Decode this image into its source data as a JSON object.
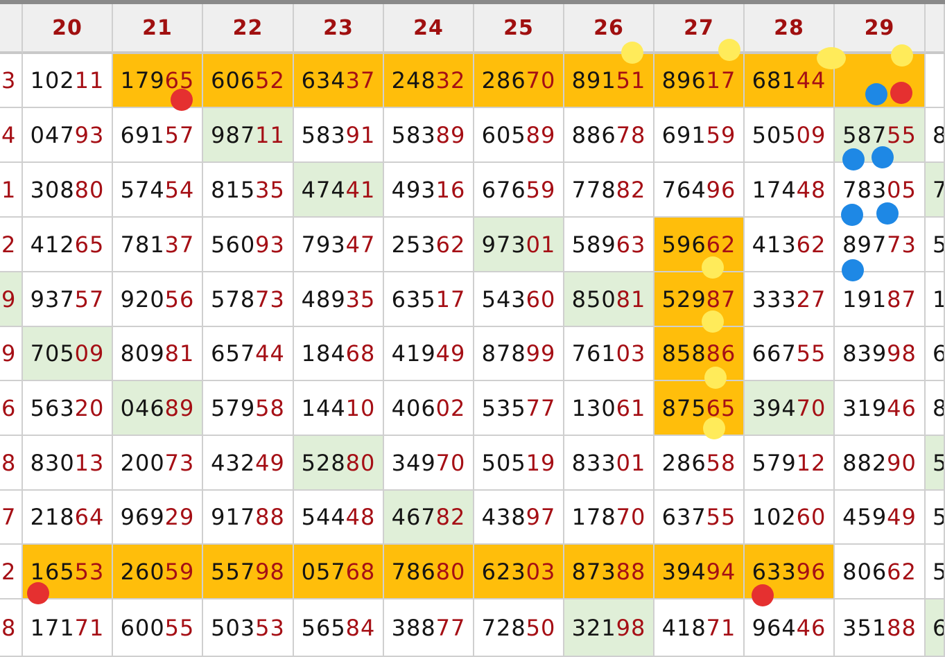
{
  "table": {
    "headers": [
      "20",
      "21",
      "22",
      "23",
      "24",
      "25",
      "26",
      "27",
      "28",
      "29"
    ],
    "left_edge_digits": [
      "3",
      "4",
      "1",
      "2",
      "9",
      "9",
      "6",
      "8",
      "7",
      "2",
      "8"
    ],
    "right_edge_digits": [
      "",
      "8",
      "7",
      "5",
      "1",
      "6",
      "8",
      "5",
      "5",
      "5",
      "6"
    ],
    "rows": [
      [
        [
          "102",
          "11"
        ],
        [
          "179",
          "65"
        ],
        [
          "606",
          "52"
        ],
        [
          "634",
          "37"
        ],
        [
          "248",
          "32"
        ],
        [
          "286",
          "70"
        ],
        [
          "891",
          "51"
        ],
        [
          "896",
          "17"
        ],
        [
          "681",
          "44"
        ],
        [
          "",
          ""
        ]
      ],
      [
        [
          "047",
          "93"
        ],
        [
          "691",
          "57"
        ],
        [
          "987",
          "11"
        ],
        [
          "583",
          "91"
        ],
        [
          "583",
          "89"
        ],
        [
          "605",
          "89"
        ],
        [
          "886",
          "78"
        ],
        [
          "691",
          "59"
        ],
        [
          "505",
          "09"
        ],
        [
          "587",
          "55"
        ]
      ],
      [
        [
          "308",
          "80"
        ],
        [
          "574",
          "54"
        ],
        [
          "815",
          "35"
        ],
        [
          "474",
          "41"
        ],
        [
          "493",
          "16"
        ],
        [
          "676",
          "59"
        ],
        [
          "778",
          "82"
        ],
        [
          "764",
          "96"
        ],
        [
          "174",
          "48"
        ],
        [
          "783",
          "05"
        ]
      ],
      [
        [
          "412",
          "65"
        ],
        [
          "781",
          "37"
        ],
        [
          "560",
          "93"
        ],
        [
          "793",
          "47"
        ],
        [
          "253",
          "62"
        ],
        [
          "973",
          "01"
        ],
        [
          "589",
          "63"
        ],
        [
          "596",
          "62"
        ],
        [
          "413",
          "62"
        ],
        [
          "897",
          "73"
        ]
      ],
      [
        [
          "937",
          "57"
        ],
        [
          "920",
          "56"
        ],
        [
          "578",
          "73"
        ],
        [
          "489",
          "35"
        ],
        [
          "635",
          "17"
        ],
        [
          "543",
          "60"
        ],
        [
          "850",
          "81"
        ],
        [
          "529",
          "87"
        ],
        [
          "333",
          "27"
        ],
        [
          "191",
          "87"
        ]
      ],
      [
        [
          "705",
          "09"
        ],
        [
          "809",
          "81"
        ],
        [
          "657",
          "44"
        ],
        [
          "184",
          "68"
        ],
        [
          "419",
          "49"
        ],
        [
          "878",
          "99"
        ],
        [
          "761",
          "03"
        ],
        [
          "858",
          "86"
        ],
        [
          "667",
          "55"
        ],
        [
          "839",
          "98"
        ]
      ],
      [
        [
          "563",
          "20"
        ],
        [
          "046",
          "89"
        ],
        [
          "579",
          "58"
        ],
        [
          "144",
          "10"
        ],
        [
          "406",
          "02"
        ],
        [
          "535",
          "77"
        ],
        [
          "130",
          "61"
        ],
        [
          "875",
          "65"
        ],
        [
          "394",
          "70"
        ],
        [
          "319",
          "46"
        ]
      ],
      [
        [
          "830",
          "13"
        ],
        [
          "200",
          "73"
        ],
        [
          "432",
          "49"
        ],
        [
          "528",
          "80"
        ],
        [
          "349",
          "70"
        ],
        [
          "505",
          "19"
        ],
        [
          "833",
          "01"
        ],
        [
          "286",
          "58"
        ],
        [
          "579",
          "12"
        ],
        [
          "882",
          "90"
        ]
      ],
      [
        [
          "218",
          "64"
        ],
        [
          "969",
          "29"
        ],
        [
          "917",
          "88"
        ],
        [
          "544",
          "48"
        ],
        [
          "467",
          "82"
        ],
        [
          "438",
          "97"
        ],
        [
          "178",
          "70"
        ],
        [
          "637",
          "55"
        ],
        [
          "102",
          "60"
        ],
        [
          "459",
          "49"
        ]
      ],
      [
        [
          "165",
          "53"
        ],
        [
          "260",
          "59"
        ],
        [
          "557",
          "98"
        ],
        [
          "057",
          "68"
        ],
        [
          "786",
          "80"
        ],
        [
          "623",
          "03"
        ],
        [
          "873",
          "88"
        ],
        [
          "394",
          "94"
        ],
        [
          "633",
          "96"
        ],
        [
          "806",
          "62"
        ]
      ],
      [
        [
          "171",
          "71"
        ],
        [
          "600",
          "55"
        ],
        [
          "503",
          "53"
        ],
        [
          "565",
          "84"
        ],
        [
          "388",
          "77"
        ],
        [
          "728",
          "50"
        ],
        [
          "321",
          "98"
        ],
        [
          "418",
          "71"
        ],
        [
          "964",
          "46"
        ],
        [
          "351",
          "88"
        ]
      ]
    ],
    "highlight_orange": [
      [
        0,
        1
      ],
      [
        0,
        2
      ],
      [
        0,
        3
      ],
      [
        0,
        4
      ],
      [
        0,
        5
      ],
      [
        0,
        6
      ],
      [
        0,
        7
      ],
      [
        0,
        8
      ],
      [
        0,
        9
      ],
      [
        3,
        7
      ],
      [
        4,
        7
      ],
      [
        5,
        7
      ],
      [
        6,
        7
      ],
      [
        9,
        0
      ],
      [
        9,
        1
      ],
      [
        9,
        2
      ],
      [
        9,
        3
      ],
      [
        9,
        4
      ],
      [
        9,
        5
      ],
      [
        9,
        6
      ],
      [
        9,
        7
      ],
      [
        9,
        8
      ]
    ],
    "highlight_green": [
      [
        1,
        2
      ],
      [
        1,
        9
      ],
      [
        2,
        3
      ],
      [
        3,
        5
      ],
      [
        4,
        6
      ],
      [
        5,
        0
      ],
      [
        6,
        1
      ],
      [
        6,
        8
      ],
      [
        7,
        3
      ],
      [
        8,
        4
      ],
      [
        10,
        6
      ]
    ],
    "left_green_rows": [
      4
    ],
    "right_green_rows": [
      2,
      7,
      10
    ],
    "colors": {
      "orange": "#ffbe0b",
      "green": "#e0efd8",
      "tail_red": "#a50f15",
      "header_red": "#a01010"
    }
  },
  "markers": [
    {
      "color": "yellow"
    },
    {
      "color": "yellow"
    },
    {
      "color": "yellow"
    },
    {
      "color": "yellow"
    },
    {
      "color": "red"
    },
    {
      "color": "blue"
    },
    {
      "color": "red"
    },
    {
      "color": "blue"
    },
    {
      "color": "blue"
    },
    {
      "color": "blue"
    },
    {
      "color": "blue"
    },
    {
      "color": "blue"
    },
    {
      "color": "yellow"
    },
    {
      "color": "yellow"
    },
    {
      "color": "yellow"
    },
    {
      "color": "yellow"
    },
    {
      "color": "red"
    },
    {
      "color": "red"
    },
    {
      "color": "yellow"
    }
  ]
}
